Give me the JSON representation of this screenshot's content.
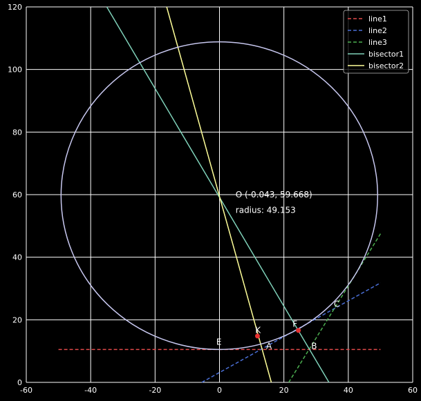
{
  "chart_data": {
    "type": "line",
    "title": "",
    "xlabel": "",
    "ylabel": "",
    "xlim": [
      -60,
      60
    ],
    "ylim": [
      0,
      120
    ],
    "xticks": [
      -60,
      -40,
      -20,
      0,
      20,
      40,
      60
    ],
    "yticks": [
      0,
      20,
      40,
      60,
      80,
      100,
      120
    ],
    "grid": true,
    "legend_position": "top-right",
    "background": "#000000",
    "grid_color": "#ffffff",
    "series": [
      {
        "name": "line1",
        "style": "dashed",
        "color": "#e24a4a",
        "x": [
          -50,
          50
        ],
        "y": [
          10.5,
          10.5
        ]
      },
      {
        "name": "line2",
        "style": "dashed",
        "color": "#4a6fd6",
        "x": [
          -5.5,
          50
        ],
        "y": [
          0,
          31.8
        ]
      },
      {
        "name": "line3",
        "style": "dashed",
        "color": "#4caf50",
        "x": [
          21.5,
          50
        ],
        "y": [
          0,
          47.5
        ]
      },
      {
        "name": "bisector1",
        "style": "solid",
        "color": "#7fd1b9",
        "x": [
          -35,
          34
        ],
        "y": [
          120,
          0
        ]
      },
      {
        "name": "bisector2",
        "style": "solid",
        "color": "#ffff99",
        "x": [
          -16.4,
          16.1
        ],
        "y": [
          120,
          0
        ]
      }
    ],
    "circle": {
      "center": [
        -0.043,
        59.668
      ],
      "radius": 49.153,
      "color": "#c8c8f0"
    },
    "points": [
      {
        "label": "E",
        "x": 0,
        "y": 10.5,
        "marker": false,
        "dx": -1,
        "dy": 1.5
      },
      {
        "label": "A",
        "x": 14,
        "y": 10.5,
        "marker": false,
        "dx": 0.5,
        "dy": 0.2
      },
      {
        "label": "B",
        "x": 28,
        "y": 10.5,
        "marker": false,
        "dx": 0.5,
        "dy": 0.2
      },
      {
        "label": "C",
        "x": 36.5,
        "y": 24,
        "marker": false,
        "dx": -1,
        "dy": 0.2
      },
      {
        "label": "K",
        "x": 11.8,
        "y": 14.8,
        "marker": true,
        "dx": -0.7,
        "dy": 1
      },
      {
        "label": "F",
        "x": 24.5,
        "y": 16.6,
        "marker": true,
        "dx": -1.8,
        "dy": 1.2
      }
    ],
    "marker_color": "#e53030",
    "annotations": [
      {
        "text": "O (-0.043, 59.668)",
        "x": 5,
        "y": 60
      },
      {
        "text": "radius: 49.153",
        "x": 5,
        "y": 55
      }
    ]
  }
}
